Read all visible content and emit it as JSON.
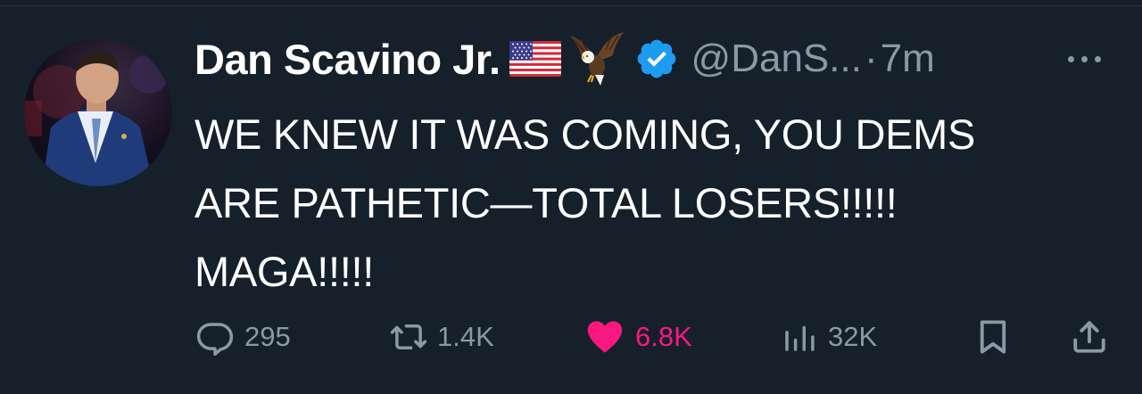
{
  "tweet": {
    "author": {
      "display_name": "Dan Scavino Jr.",
      "emojis": [
        "us-flag-emoji",
        "eagle-emoji"
      ],
      "verified": true,
      "handle": "@DanS...",
      "separator": "·",
      "time": "7m"
    },
    "text_lines": [
      "WE KNEW IT WAS COMING, YOU DEMS",
      "ARE PATHETIC—TOTAL LOSERS!!!!!",
      "MAGA!!!!!"
    ],
    "actions": {
      "replies": "295",
      "reposts": "1.4K",
      "likes": "6.8K",
      "views": "32K"
    },
    "liked": true
  },
  "colors": {
    "background": "#15202b",
    "text": "#ffffff",
    "muted": "#8b98a5",
    "like": "#f91880",
    "verified": "#1d9bf0"
  }
}
